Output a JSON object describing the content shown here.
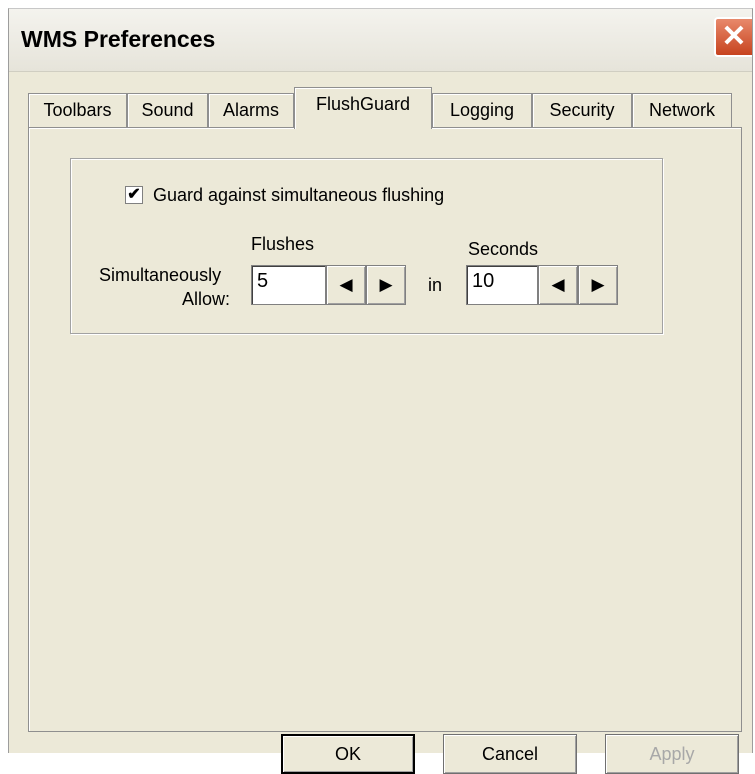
{
  "window": {
    "title": "WMS Preferences",
    "close_glyph": "✕"
  },
  "tabs": [
    {
      "label": "Toolbars",
      "active": false
    },
    {
      "label": "Sound",
      "active": false
    },
    {
      "label": "Alarms",
      "active": false
    },
    {
      "label": "FlushGuard",
      "active": true
    },
    {
      "label": "Logging",
      "active": false
    },
    {
      "label": "Security",
      "active": false
    },
    {
      "label": "Network",
      "active": false
    }
  ],
  "flushguard": {
    "guard_checkbox": {
      "label": "Guard against simultaneous flushing",
      "checked": true,
      "check_glyph": "✔"
    },
    "simultaneously_label_line1": "Simultaneously",
    "simultaneously_label_line2": "Allow:",
    "flushes_label": "Flushes",
    "flushes_value": "5",
    "in_label": "in",
    "seconds_label": "Seconds",
    "seconds_value": "10",
    "spin_left_glyph": "◀",
    "spin_right_glyph": "▶"
  },
  "buttons": {
    "ok": "OK",
    "cancel": "Cancel",
    "apply": "Apply"
  },
  "colors": {
    "dialog_bg": "#ece9d8",
    "close_button": "#c7431f"
  }
}
